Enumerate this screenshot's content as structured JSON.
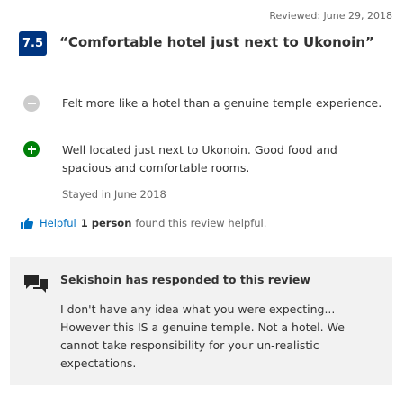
{
  "review": {
    "reviewed_date": "Reviewed: June 29, 2018",
    "score": "7.5",
    "title": "“Comfortable hotel just next to Ukonoin”",
    "negative": "Felt more like a hotel than a genuine temple experience.",
    "positive": "Well located just next to Ukonoin.  Good food and spacious and comfortable rooms.",
    "stayed": "Stayed in June 2018"
  },
  "helpful": {
    "link_label": "Helpful",
    "count": "1 person",
    "suffix": "found this review helpful."
  },
  "response": {
    "title": "Sekishoin has responded to this review",
    "body": "I don't have any idea what you were expecting... However this IS a genuine temple. Not a hotel. We cannot take responsibility for your un-realistic expectations."
  },
  "colors": {
    "score_badge": "#003580",
    "positive_icon": "#008009",
    "negative_icon": "#cccccc",
    "link": "#0071c2",
    "response_bg": "#f2f2f2"
  },
  "icons": {
    "negative": "minus-circle-icon",
    "positive": "plus-circle-icon",
    "helpful": "thumbs-up-icon",
    "response": "chat-bubbles-icon"
  }
}
